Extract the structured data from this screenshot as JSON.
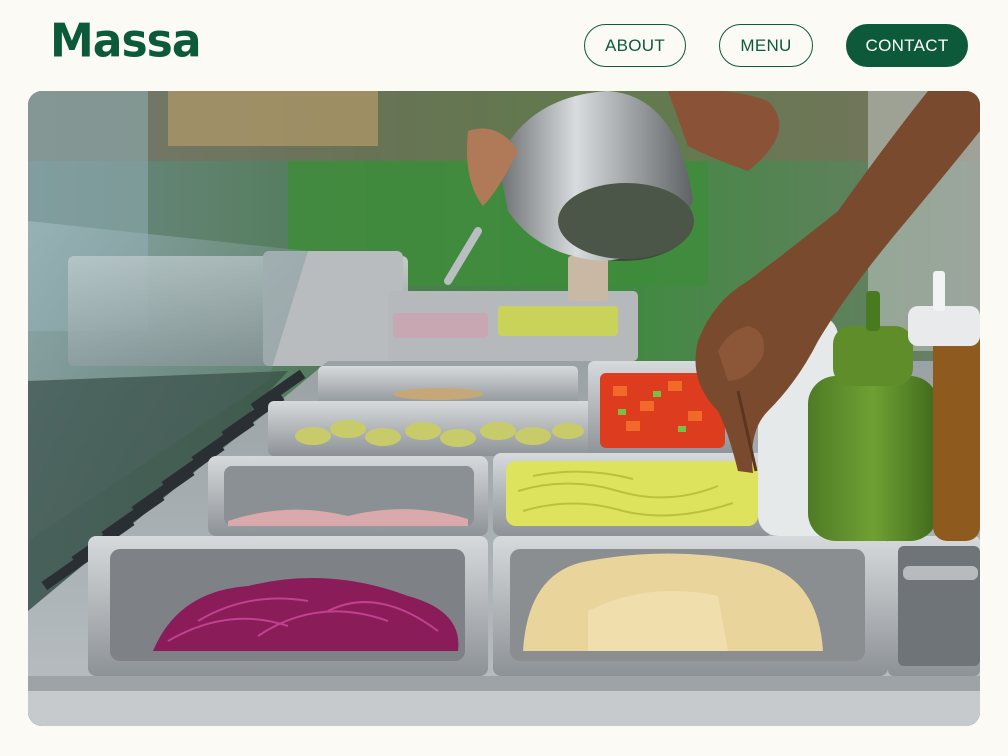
{
  "brand": {
    "logo_text": "Massa",
    "color": "#0d5a3a"
  },
  "nav": {
    "items": [
      {
        "label": "ABOUT"
      },
      {
        "label": "MENU"
      },
      {
        "label": "CONTACT"
      }
    ]
  },
  "hero": {
    "image_subject": "salad-bar-photo"
  }
}
